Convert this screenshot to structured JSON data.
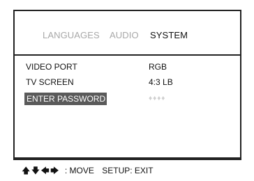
{
  "tabs": [
    {
      "label": "LANGUAGES",
      "active": false
    },
    {
      "label": "AUDIO",
      "active": false
    },
    {
      "label": "SYSTEM",
      "active": true
    }
  ],
  "settings": [
    {
      "label": "VIDEO PORT",
      "value": "RGB"
    },
    {
      "label": "TV SCREEN",
      "value": "4:3 LB"
    },
    {
      "label": "ENTER PASSWORD",
      "value": "♦♦♦♦",
      "selected": true
    }
  ],
  "footer": {
    "arrows": [
      "up-arrow-icon",
      "down-arrow-icon",
      "left-arrow-icon",
      "right-arrow-icon"
    ],
    "move_label": ": MOVE",
    "exit_label": "SETUP: EXIT"
  },
  "colors": {
    "border": "#222222",
    "inactive_tab": "#a8a8a8",
    "selection": "#5a5a5a",
    "password_mask": "#d0d0d0"
  }
}
